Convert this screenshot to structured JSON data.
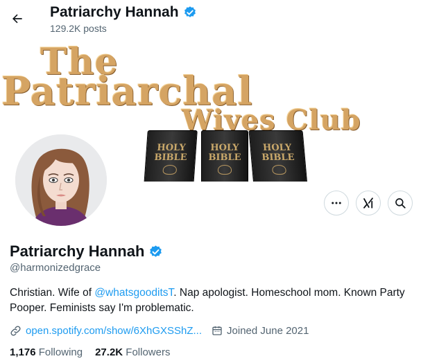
{
  "header": {
    "title": "Patriarchy Hannah",
    "posts_count": "129.2K posts"
  },
  "banner": {
    "line1": "The",
    "line2": "Patriarchal",
    "line3": "Wives Club",
    "books": [
      "HOLY BIBLE",
      "HOLY BIBLE",
      "HOLY BIBLE"
    ]
  },
  "profile": {
    "name": "Patriarchy Hannah",
    "handle": "@harmonizedgrace",
    "bio_before": "Christian. Wife of ",
    "bio_mention": "@whatsgooditsT",
    "bio_after": ". Nap apologist. Homeschool mom. Known Party Pooper. Feminists say I'm problematic.",
    "link": "open.spotify.com/show/6XhGXSShZ...",
    "joined": "Joined June 2021"
  },
  "stats": {
    "following_count": "1,176",
    "following_label": "Following",
    "followers_count": "27.2K",
    "followers_label": "Followers"
  },
  "colors": {
    "accent": "#1d9bf0",
    "verified": "#1d9bf0",
    "muted": "#536471",
    "banner_text": "#d5a463"
  },
  "icons": {
    "back": "arrow-left-icon",
    "verified": "verified-badge-icon",
    "more": "more-dots-icon",
    "grok": "grok-icon",
    "search": "search-icon",
    "link": "link-icon",
    "calendar": "calendar-icon"
  }
}
